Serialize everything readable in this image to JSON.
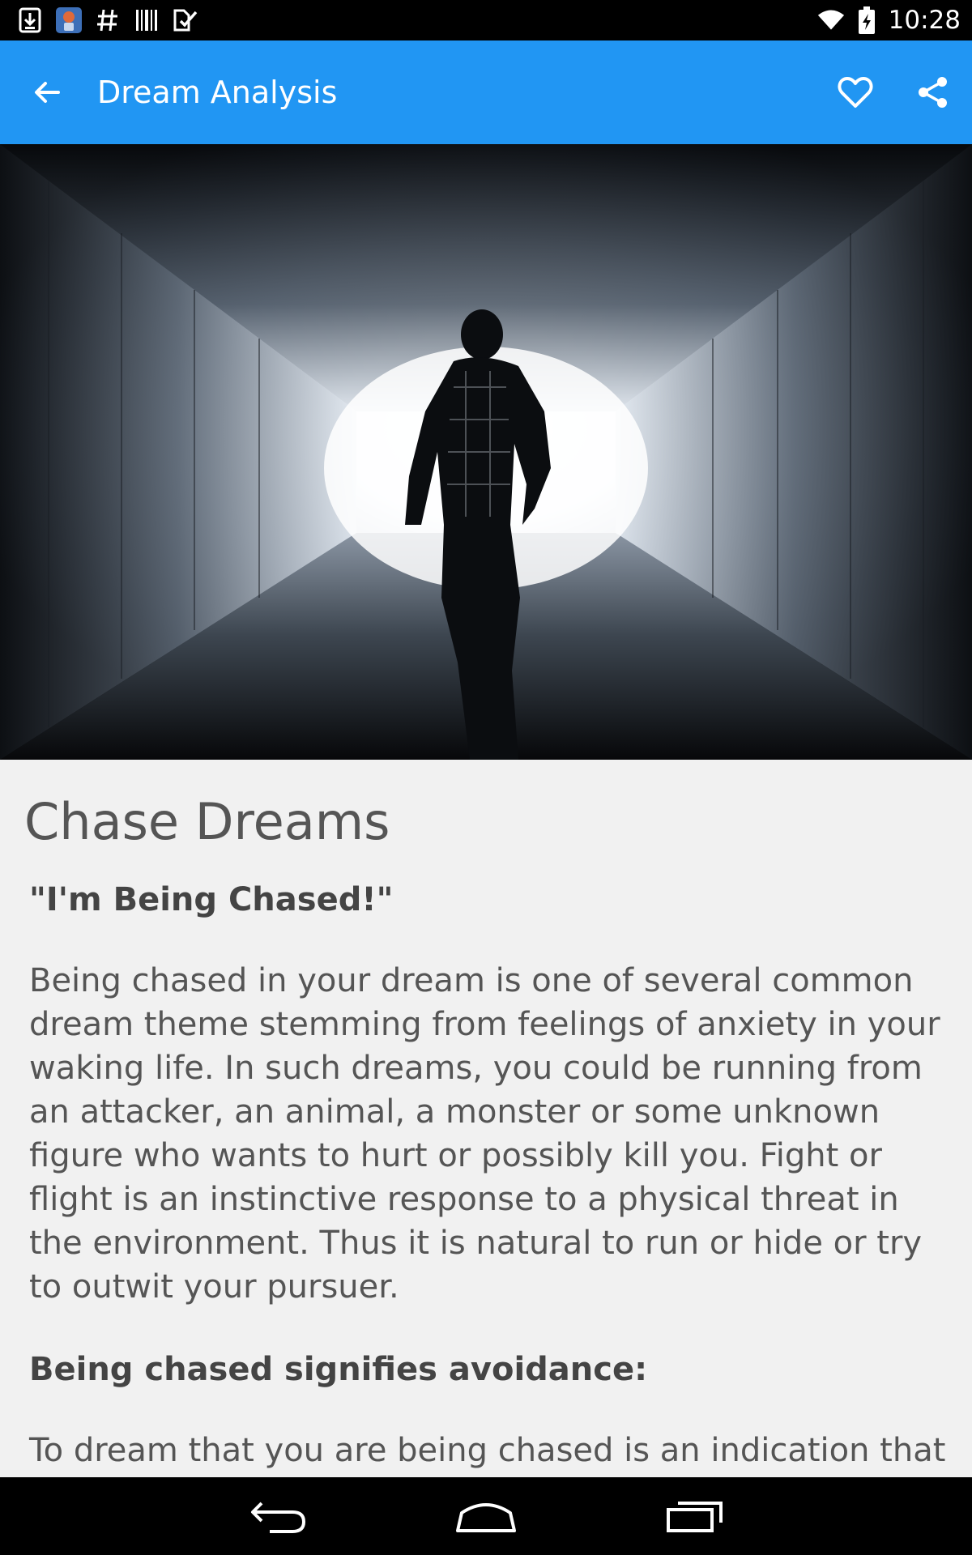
{
  "status_bar": {
    "time": "10:28",
    "left_icons": [
      "download-icon",
      "app-notification-icon",
      "hashtag-icon",
      "barcode-icon",
      "checklist-icon"
    ],
    "right_icons": [
      "wifi-icon",
      "battery-charging-icon"
    ]
  },
  "app_bar": {
    "title": "Dream Analysis",
    "background": "#2196f3"
  },
  "article": {
    "title": "Chase Dreams",
    "subheading": "\"I'm Being Chased!\"",
    "paragraph": "Being chased in your dream is one of several common dream theme stemming from feelings of anxiety in your waking life. In such dreams, you could be running from an attacker, an animal, a monster or some unknown figure who wants to hurt or possibly kill you. Fight or flight is an instinctive response to a physical threat in the environment. Thus it is natural to run or hide or try to outwit your pursuer.",
    "subheading2": "Being chased signifies avoidance:",
    "paragraph2": "To dream that you are being chased is an indication that"
  },
  "nav_bar": {
    "buttons": [
      "back-icon",
      "home-icon",
      "recents-icon"
    ]
  }
}
